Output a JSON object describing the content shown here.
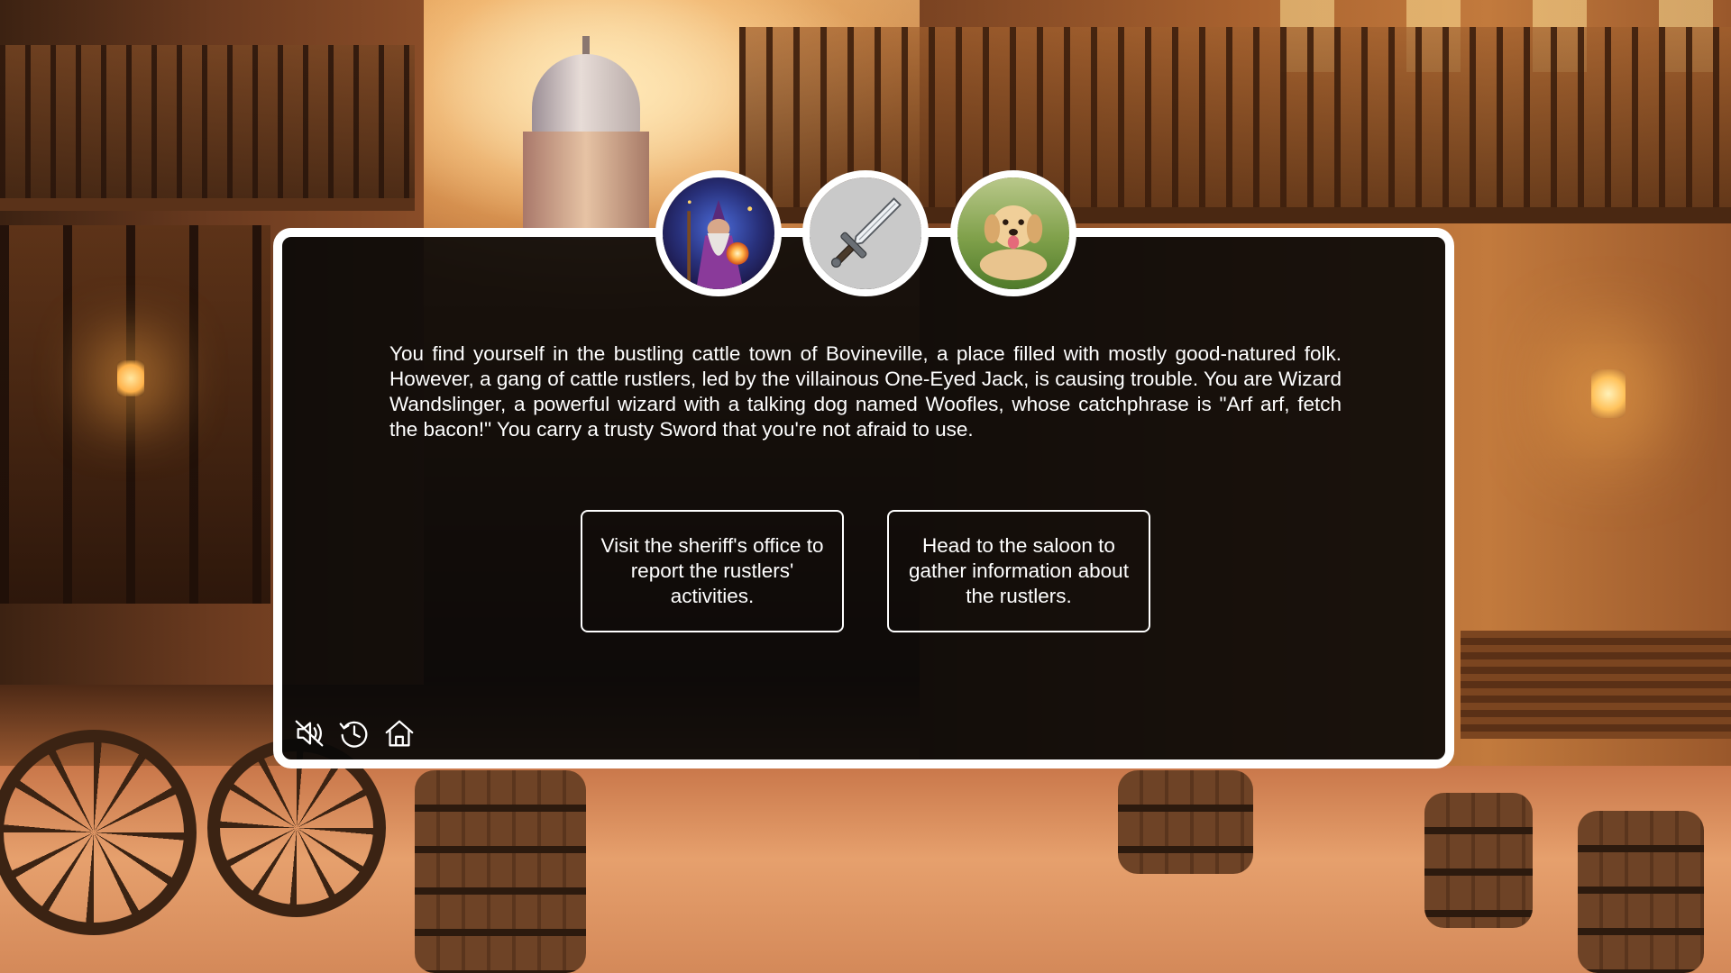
{
  "story": {
    "text": "You find yourself in the bustling cattle town of Bovineville, a place filled with mostly good-natured folk. However, a gang of cattle rustlers, led by the villainous One-Eyed Jack, is causing trouble. You are Wizard Wandslinger, a powerful wizard with a talking dog named Woofles, whose catchphrase is \"Arf arf, fetch the bacon!\" You carry a trusty Sword that you're not afraid to use."
  },
  "avatars": [
    {
      "icon": "wizard-portrait"
    },
    {
      "icon": "sword-icon"
    },
    {
      "icon": "dog-portrait"
    }
  ],
  "choices": [
    {
      "label": "Visit the sheriff's office to report the rustlers' activities."
    },
    {
      "label": "Head to the saloon to gather information about the rustlers."
    }
  ],
  "toolbar": [
    {
      "icon": "mute-icon"
    },
    {
      "icon": "history-icon"
    },
    {
      "icon": "home-icon"
    }
  ],
  "colors": {
    "panel_border": "#ffffff",
    "panel_background": "#080808",
    "text": "#ffffff"
  }
}
